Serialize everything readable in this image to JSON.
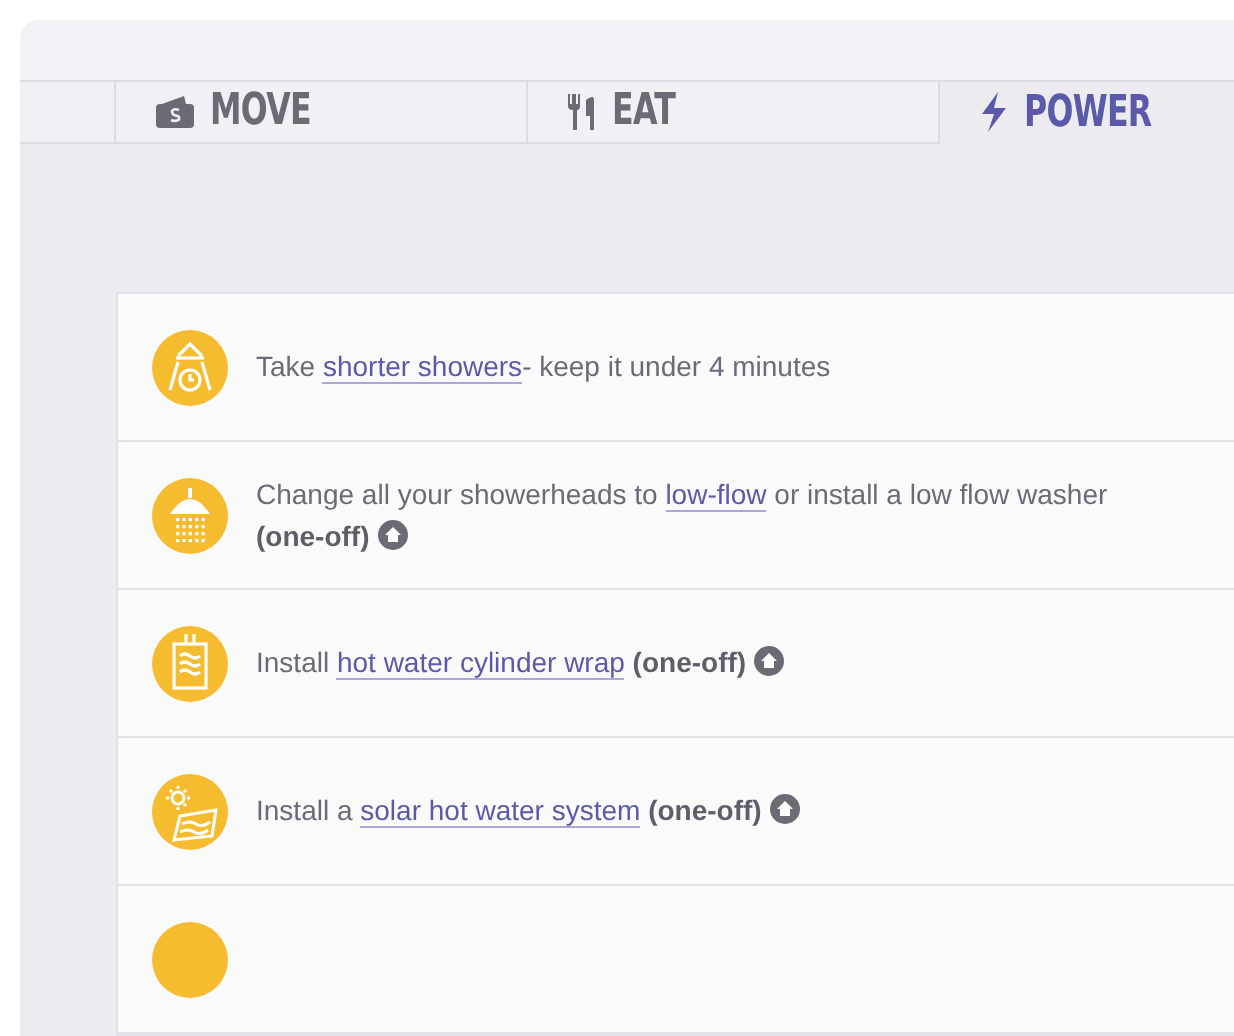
{
  "tabs": [
    {
      "selected": false
    },
    {
      "label": "MOVE",
      "selected": false
    },
    {
      "label": "EAT",
      "selected": false
    },
    {
      "label": "POWER",
      "selected": true
    }
  ],
  "actions": [
    {
      "parts": [
        {
          "kind": "text",
          "text": "Take "
        },
        {
          "kind": "link",
          "text": "shorter showers"
        },
        {
          "kind": "text",
          "text": "- keep it under 4 minutes"
        }
      ],
      "home_icon": false
    },
    {
      "parts": [
        {
          "kind": "text",
          "text": "Change all your showerheads to "
        },
        {
          "kind": "link",
          "text": "low-flow"
        },
        {
          "kind": "text",
          "text": " or install a low flow washer "
        },
        {
          "kind": "bold",
          "text": "(one-off)"
        }
      ],
      "home_icon": true
    },
    {
      "parts": [
        {
          "kind": "text",
          "text": "Install "
        },
        {
          "kind": "link",
          "text": "hot water cylinder wrap"
        },
        {
          "kind": "bold",
          "text": " (one-off)"
        }
      ],
      "home_icon": true
    },
    {
      "parts": [
        {
          "kind": "text",
          "text": "Install a "
        },
        {
          "kind": "link",
          "text": "solar hot water system"
        },
        {
          "kind": "bold",
          "text": " (one-off)"
        }
      ],
      "home_icon": true
    }
  ]
}
